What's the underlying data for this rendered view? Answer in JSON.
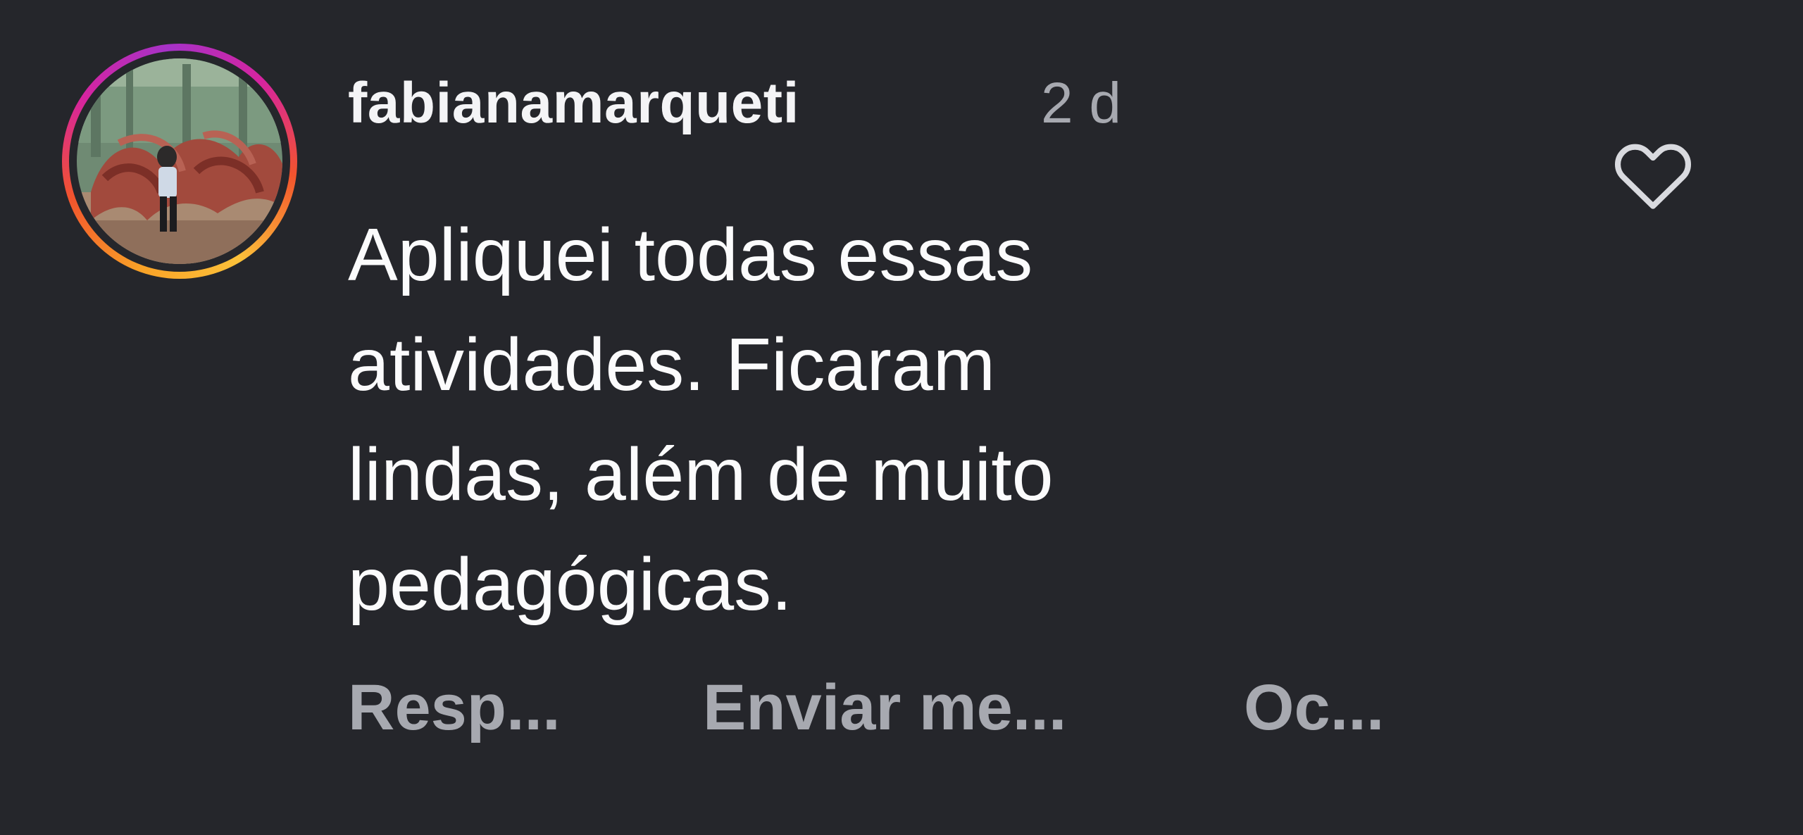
{
  "comment": {
    "username": "fabianamarqueti",
    "timestamp": "2 d",
    "text": "Apliquei todas essas\natividades.  Ficaram\nlindas, além de muito\npedagógicas.",
    "avatar": {
      "type": "story-ring-photo"
    },
    "like_icon": "heart-outline-icon"
  },
  "actions": {
    "reply": "Resp...",
    "send_message": "Enviar me...",
    "hide": "Oc..."
  },
  "colors": {
    "background": "#25262b",
    "username": "#f4f4f6",
    "body_text": "#fbfbfc",
    "muted": "#a7a9b0",
    "story_ring": [
      "#fcc13a",
      "#f2542d",
      "#d6249f",
      "#a632c8"
    ]
  }
}
